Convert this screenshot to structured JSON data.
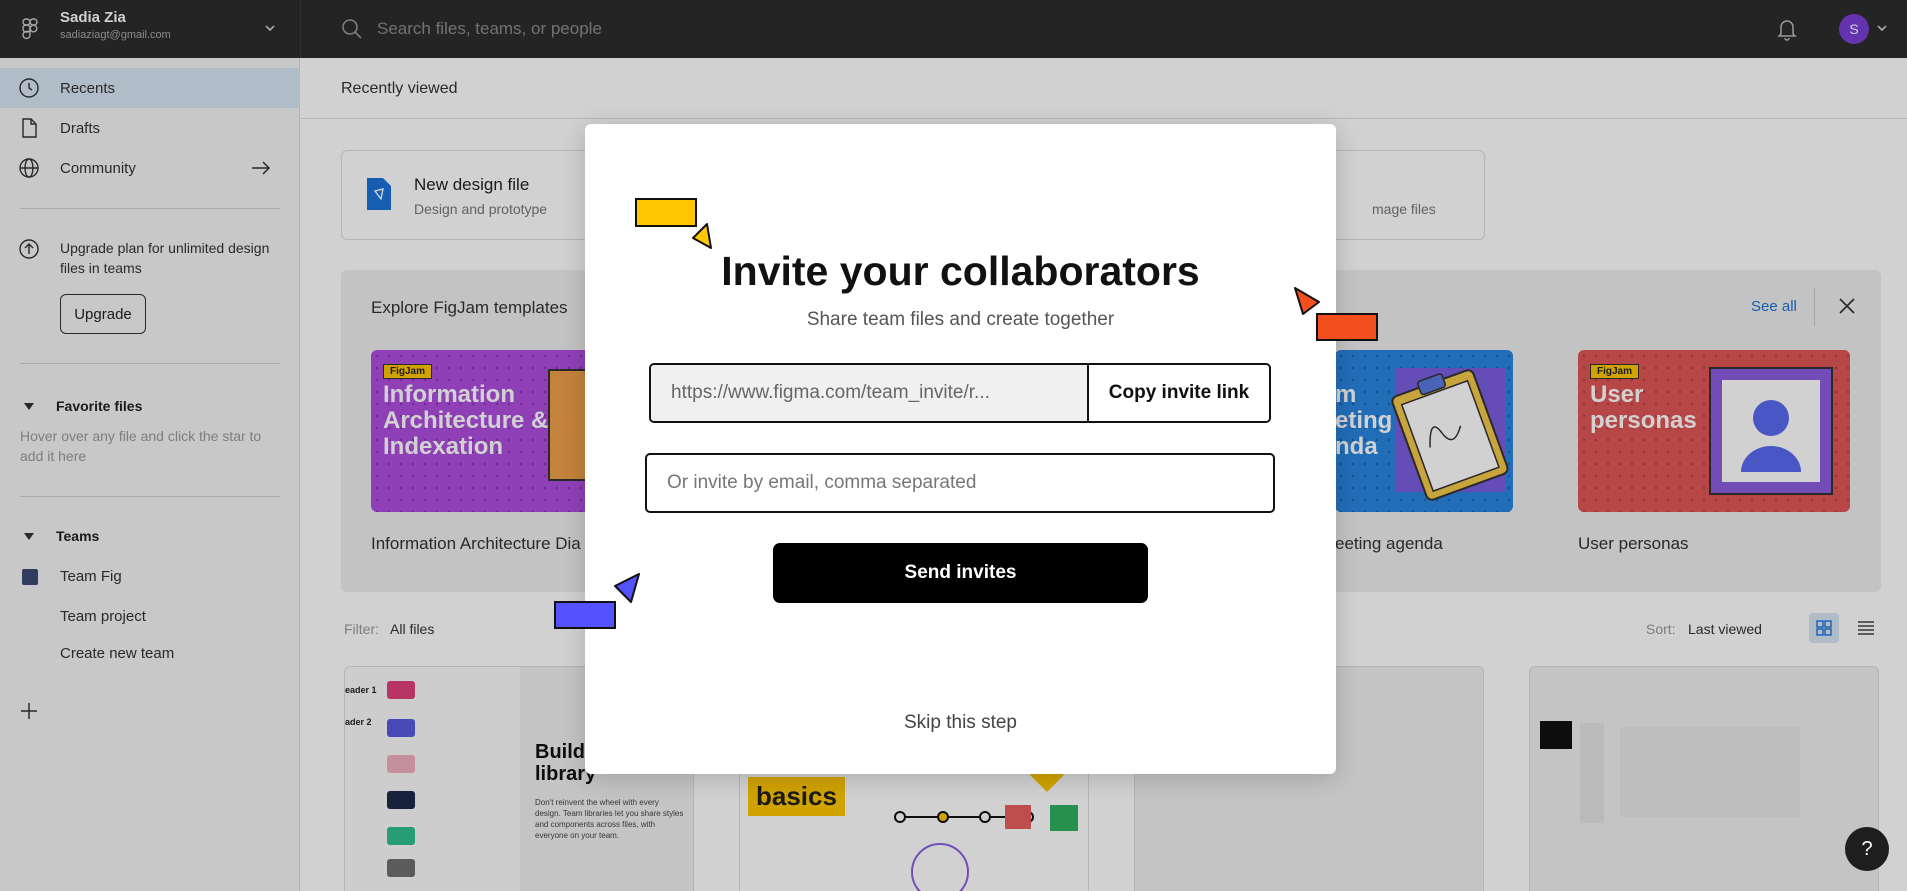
{
  "topbar": {
    "user_name": "Sadia Zia",
    "user_email": "sadiaziagt@gmail.com",
    "search_placeholder": "Search files, teams, or people",
    "avatar_initial": "S"
  },
  "sidebar": {
    "nav": [
      {
        "label": "Recents",
        "active": true
      },
      {
        "label": "Drafts",
        "active": false
      },
      {
        "label": "Community",
        "active": false
      }
    ],
    "upgrade_text": "Upgrade plan for unlimited design files in teams",
    "upgrade_button": "Upgrade",
    "favorites_heading": "Favorite files",
    "favorites_hint": "Hover over any file and click the star to add it here",
    "teams_heading": "Teams",
    "teams": [
      "Team Fig",
      "Team project"
    ],
    "create_team": "Create new team"
  },
  "main": {
    "recent_heading": "Recently viewed",
    "new_file_title": "New design file",
    "new_file_sub": "Design and prototype",
    "import_sub": "mage files",
    "templates_heading": "Explore FigJam templates",
    "see_all": "See all",
    "template_labels": [
      "Information Architecture Dia",
      "eeting agenda",
      "User personas"
    ],
    "thumb_texts": {
      "t1_tag": "FigJam",
      "t1_title": "Information Architecture & Indexation",
      "t2_title": "m eting nda",
      "t3_tag": "FigJam",
      "t3_title": "User personas"
    },
    "filter_label": "Filter:",
    "filter_value": "All files",
    "sort_label": "Sort:",
    "sort_value": "Last viewed",
    "file_card_texts": {
      "c1_title": "Build team library",
      "c1_body": "Don't reinvent the wheel with every design. Team libraries let you share styles and components across files, with everyone on your team.",
      "c1_rows": [
        "eader 1",
        "ader 2"
      ],
      "c2_title": "basics"
    }
  },
  "modal": {
    "title": "Invite your collaborators",
    "subtitle": "Share team files and create together",
    "invite_link": "https://www.figma.com/team_invite/r...",
    "copy_button": "Copy invite link",
    "email_placeholder": "Or invite by email, comma separated",
    "send_button": "Send invites",
    "skip": "Skip this step"
  },
  "colors": {
    "topbar_bg": "#2c2c2c",
    "active_nav": "#d7e6f5",
    "link_blue": "#1a73d9",
    "avatar": "#7b3fd6",
    "deco_yellow": "#ffc700",
    "deco_orange": "#f24e1e",
    "deco_blue": "#5551ff"
  },
  "help": "?"
}
